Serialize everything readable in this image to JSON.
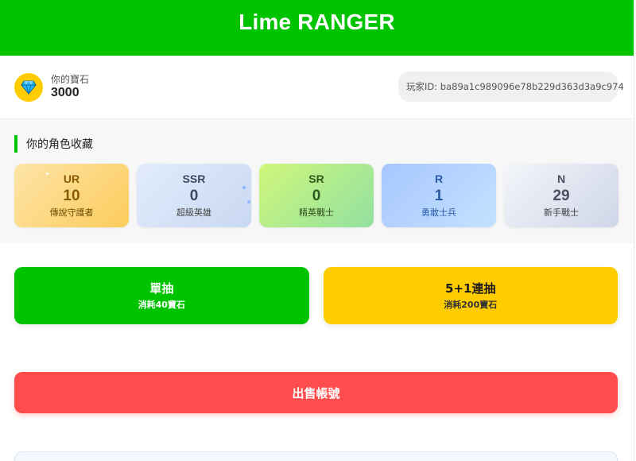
{
  "header": {
    "title": "Lime RANGER"
  },
  "wallet": {
    "label": "你的寶石",
    "value": "3000",
    "icon": "diamond-icon"
  },
  "player": {
    "id_text": "玩家ID: ba89a1c989096e78b229d363d3a9c974"
  },
  "collection": {
    "title": "你的角色收藏",
    "cards": [
      {
        "tier": "UR",
        "count": "10",
        "name": "傳說守護者"
      },
      {
        "tier": "SSR",
        "count": "0",
        "name": "超級英雄"
      },
      {
        "tier": "SR",
        "count": "0",
        "name": "精英戰士"
      },
      {
        "tier": "R",
        "count": "1",
        "name": "勇敢士兵"
      },
      {
        "tier": "N",
        "count": "29",
        "name": "新手戰士"
      }
    ]
  },
  "draws": {
    "single": {
      "title": "單抽",
      "cost": "消耗40寶石"
    },
    "multi": {
      "title": "5+1連抽",
      "cost": "消耗200寶石"
    }
  },
  "sell": {
    "label": "出售帳號"
  },
  "colors": {
    "brand_green": "#00c300",
    "gold": "#ffcc00",
    "danger_red": "#ff4d4d"
  }
}
